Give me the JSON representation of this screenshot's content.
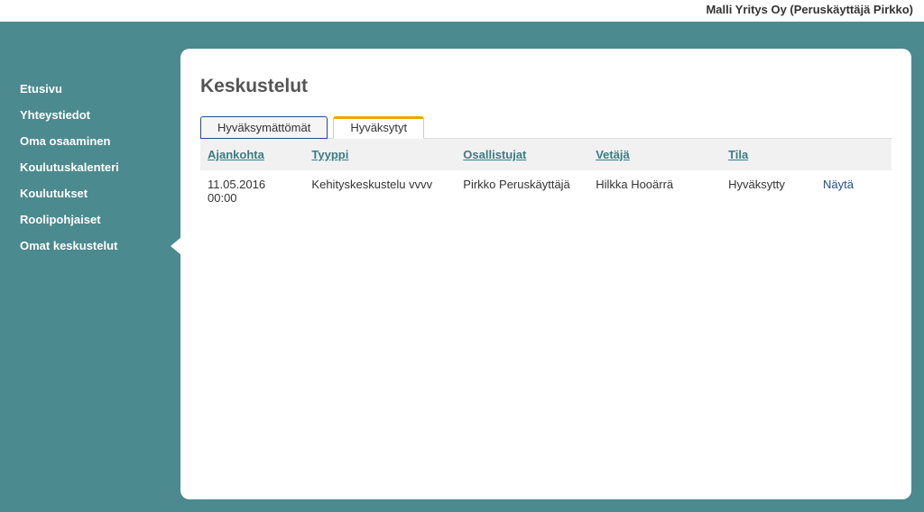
{
  "header": {
    "user_context": "Malli Yritys Oy (Peruskäyttäjä Pirkko)"
  },
  "sidebar": {
    "items": [
      {
        "label": "Etusivu"
      },
      {
        "label": "Yhteystiedot"
      },
      {
        "label": "Oma osaaminen"
      },
      {
        "label": "Koulutuskalenteri"
      },
      {
        "label": "Koulutukset"
      },
      {
        "label": "Roolipohjaiset"
      },
      {
        "label": "Omat keskustelut"
      }
    ],
    "active_index": 6
  },
  "page": {
    "title": "Keskustelut"
  },
  "tabs": [
    {
      "label": "Hyväksymättömät",
      "active": false
    },
    {
      "label": "Hyväksytyt",
      "active": true
    }
  ],
  "table": {
    "headers": {
      "time": "Ajankohta",
      "type": "Tyyppi",
      "participants": "Osallistujat",
      "leader": "Vetäjä",
      "status": "Tila"
    },
    "rows": [
      {
        "time": "11.05.2016 00:00",
        "type": "Kehityskeskustelu vvvv",
        "participants": "Pirkko Peruskäyttäjä",
        "leader": "Hilkka Hooärrä",
        "status": "Hyväksytty",
        "action": "Näytä"
      }
    ]
  }
}
